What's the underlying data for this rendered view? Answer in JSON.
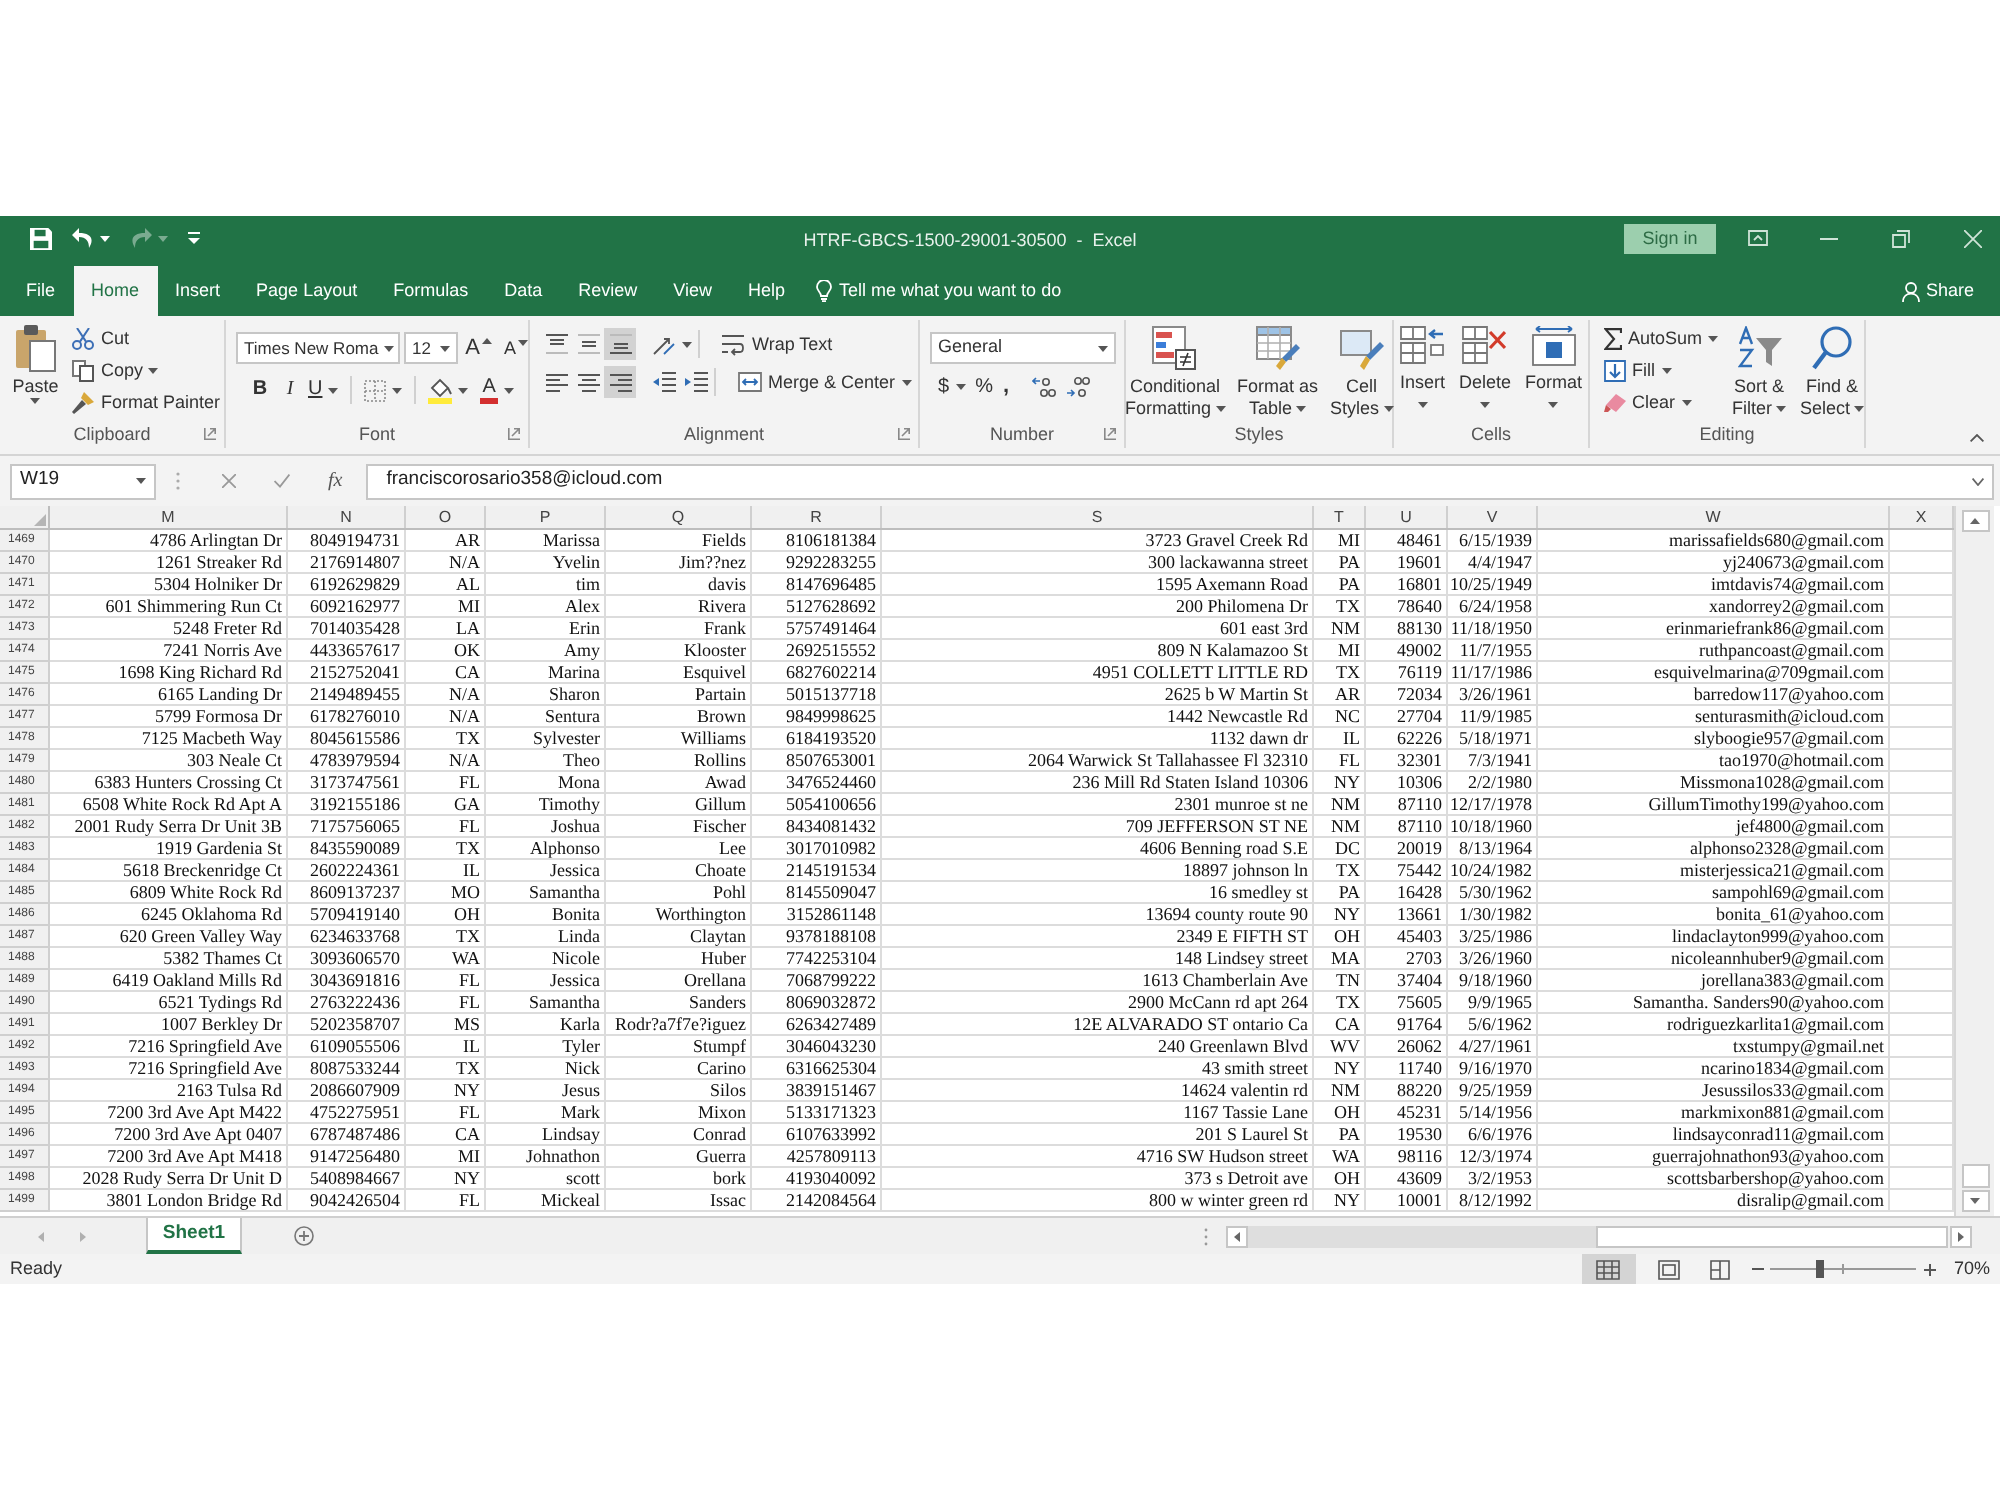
{
  "window": {
    "title": "HTRF-GBCS-1500-29001-30500  -  Excel",
    "sign_in": "Sign in"
  },
  "quick_access": {
    "redo": {
      "disabled": true
    }
  },
  "ribbon_tabs": [
    {
      "label": "File",
      "selected": false
    },
    {
      "label": "Home",
      "selected": true
    },
    {
      "label": "Insert",
      "selected": false
    },
    {
      "label": "Page Layout",
      "selected": false
    },
    {
      "label": "Formulas",
      "selected": false
    },
    {
      "label": "Data",
      "selected": false
    },
    {
      "label": "Review",
      "selected": false
    },
    {
      "label": "View",
      "selected": false
    },
    {
      "label": "Help",
      "selected": false
    }
  ],
  "tell_me": {
    "placeholder": "Tell me what you want to do"
  },
  "share": "Share",
  "clipboard": {
    "paste": "Paste",
    "cut": "Cut",
    "copy": "Copy",
    "format_painter": "Format Painter",
    "group_label": "Clipboard"
  },
  "font": {
    "name": "Times New Roma",
    "size": "12",
    "grow": "A",
    "shrink": "A",
    "bold": "B",
    "italic": "I",
    "underline": "U",
    "font_color": "A",
    "group_label": "Font"
  },
  "alignment": {
    "vertical": [
      {
        "kind": "top",
        "selected": false
      },
      {
        "kind": "middle",
        "selected": false
      },
      {
        "kind": "bottom",
        "selected": true
      }
    ],
    "horizontal": [
      {
        "kind": "left",
        "selected": false
      },
      {
        "kind": "center",
        "selected": false
      },
      {
        "kind": "right",
        "selected": true
      }
    ],
    "wrap_text": "Wrap Text",
    "merge_center": "Merge & Center",
    "group_label": "Alignment"
  },
  "number": {
    "format": "General",
    "currency": "$",
    "percent": "%",
    "comma": ",",
    "group_label": "Number"
  },
  "styles": {
    "buttons": [
      {
        "kind": "conditional",
        "lines": [
          "Conditional",
          "Formatting"
        ]
      },
      {
        "kind": "table",
        "lines": [
          "Format as",
          "Table"
        ]
      },
      {
        "kind": "cell",
        "lines": [
          "Cell",
          "Styles"
        ]
      }
    ],
    "group_label": "Styles"
  },
  "cells": {
    "buttons": [
      {
        "kind": "insert",
        "label": "Insert"
      },
      {
        "kind": "delete",
        "label": "Delete"
      },
      {
        "kind": "format",
        "label": "Format"
      }
    ],
    "group_label": "Cells"
  },
  "editing": {
    "autosum": "AutoSum",
    "fill": "Fill",
    "clear": "Clear",
    "buttons": [
      {
        "kind": "sort",
        "lines": [
          "Sort &",
          "Filter"
        ]
      },
      {
        "kind": "find",
        "lines": [
          "Find &",
          "Select"
        ]
      }
    ],
    "group_label": "Editing"
  },
  "formula_bar": {
    "name_box": "W19",
    "function_label": "fx",
    "formula": "franciscorosario358@icloud.com"
  },
  "columns": [
    "M",
    "N",
    "O",
    "P",
    "Q",
    "R",
    "S",
    "T",
    "U",
    "V",
    "W",
    "X"
  ],
  "rows": [
    {
      "header": "1469",
      "cells": [
        "4786 Arlingtan Dr",
        "8049194731",
        "AR",
        "Marissa",
        "Fields",
        "8106181384",
        "3723 Gravel Creek Rd",
        "MI",
        "48461",
        "6/15/1939",
        "marissafields680@gmail.com"
      ]
    },
    {
      "header": "1470",
      "cells": [
        "1261 Streaker Rd",
        "2176914807",
        "N/A",
        "Yvelin",
        "Jim??nez",
        "9292283255",
        "300 lackawanna street",
        "PA",
        "19601",
        "4/4/1947",
        "yj240673@gmail.com"
      ]
    },
    {
      "header": "1471",
      "cells": [
        "5304 Holniker Dr",
        "6192629829",
        "AL",
        "tim",
        "davis",
        "8147696485",
        "1595 Axemann Road",
        "PA",
        "16801",
        "10/25/1949",
        "imtdavis74@gmail.com"
      ]
    },
    {
      "header": "1472",
      "cells": [
        "601 Shimmering Run Ct",
        "6092162977",
        "MI",
        "Alex",
        "Rivera",
        "5127628692",
        "200 Philomena Dr",
        "TX",
        "78640",
        "6/24/1958",
        "xandorrey2@gmail.com"
      ]
    },
    {
      "header": "1473",
      "cells": [
        "5248 Freter Rd",
        "7014035428",
        "LA",
        "Erin",
        "Frank",
        "5757491464",
        "601 east 3rd",
        "NM",
        "88130",
        "11/18/1950",
        "erinmariefrank86@gmail.com"
      ]
    },
    {
      "header": "1474",
      "cells": [
        "7241 Norris Ave",
        "4433657617",
        "OK",
        "Amy",
        "Klooster",
        "2692515552",
        "809 N Kalamazoo St",
        "MI",
        "49002",
        "11/7/1955",
        "ruthpancoast@gmail.com"
      ]
    },
    {
      "header": "1475",
      "cells": [
        "1698 King Richard Rd",
        "2152752041",
        "CA",
        "Marina",
        "Esquivel",
        "6827602214",
        "4951 COLLETT LITTLE RD",
        "TX",
        "76119",
        "11/17/1986",
        "esquivelmarina@709gmail.com"
      ]
    },
    {
      "header": "1476",
      "cells": [
        "6165 Landing Dr",
        "2149489455",
        "N/A",
        "Sharon",
        "Partain",
        "5015137718",
        "2625 b W Martin St",
        "AR",
        "72034",
        "3/26/1961",
        "barredow117@yahoo.com"
      ]
    },
    {
      "header": "1477",
      "cells": [
        "5799 Formosa Dr",
        "6178276010",
        "N/A",
        "Sentura",
        "Brown",
        "9849998625",
        "1442 Newcastle Rd",
        "NC",
        "27704",
        "11/9/1985",
        "senturasmith@icloud.com"
      ]
    },
    {
      "header": "1478",
      "cells": [
        "7125 Macbeth Way",
        "8045615586",
        "TX",
        "Sylvester",
        "Williams",
        "6184193520",
        "1132 dawn dr",
        "IL",
        "62226",
        "5/18/1971",
        "slyboogie957@gmail.com"
      ]
    },
    {
      "header": "1479",
      "cells": [
        "303 Neale Ct",
        "4783979594",
        "N/A",
        "Theo",
        "Rollins",
        "8507653001",
        "2064 Warwick St Tallahassee Fl 32310",
        "FL",
        "32301",
        "7/3/1941",
        "tao1970@hotmail.com"
      ]
    },
    {
      "header": "1480",
      "cells": [
        "6383 Hunters Crossing Ct",
        "3173747561",
        "FL",
        "Mona",
        "Awad",
        "3476524460",
        "236 Mill Rd Staten Island 10306",
        "NY",
        "10306",
        "2/2/1980",
        "Missmona1028@gmail.com"
      ]
    },
    {
      "header": "1481",
      "cells": [
        "6508 White Rock Rd Apt A",
        "3192155186",
        "GA",
        "Timothy",
        "Gillum",
        "5054100656",
        "2301 munroe st ne",
        "NM",
        "87110",
        "12/17/1978",
        "GillumTimothy199@yahoo.com"
      ]
    },
    {
      "header": "1482",
      "cells": [
        "2001 Rudy Serra Dr Unit 3B",
        "7175756065",
        "FL",
        "Joshua",
        "Fischer",
        "8434081432",
        "709 JEFFERSON ST NE",
        "NM",
        "87110",
        "10/18/1960",
        "jef4800@gmail.com"
      ]
    },
    {
      "header": "1483",
      "cells": [
        "1919 Gardenia St",
        "8435590089",
        "TX",
        "Alphonso",
        "Lee",
        "3017010982",
        "4606 Benning road S.E",
        "DC",
        "20019",
        "8/13/1964",
        "alphonso2328@gmail.com"
      ]
    },
    {
      "header": "1484",
      "cells": [
        "5618 Breckenridge Ct",
        "2602224361",
        "IL",
        "Jessica",
        "Choate",
        "2145191534",
        "18897 johnson ln",
        "TX",
        "75442",
        "10/24/1982",
        "misterjessica21@gmail.com"
      ]
    },
    {
      "header": "1485",
      "cells": [
        "6809 White Rock Rd",
        "8609137237",
        "MO",
        "Samantha",
        "Pohl",
        "8145509047",
        "16 smedley st",
        "PA",
        "16428",
        "5/30/1962",
        "sampohl69@gmail.com"
      ]
    },
    {
      "header": "1486",
      "cells": [
        "6245 Oklahoma Rd",
        "5709419140",
        "OH",
        "Bonita",
        "Worthington",
        "3152861148",
        "13694 county route 90",
        "NY",
        "13661",
        "1/30/1982",
        "bonita_61@yahoo.com"
      ]
    },
    {
      "header": "1487",
      "cells": [
        "620 Green Valley Way",
        "6234633768",
        "TX",
        "Linda",
        "Claytan",
        "9378188108",
        "2349 E FIFTH ST",
        "OH",
        "45403",
        "3/25/1986",
        "lindaclayton999@yahoo.com"
      ]
    },
    {
      "header": "1488",
      "cells": [
        "5382 Thames Ct",
        "3093606570",
        "WA",
        "Nicole",
        "Huber",
        "7742253104",
        "148 Lindsey street",
        "MA",
        "2703",
        "3/26/1960",
        "nicoleannhuber9@gmail.com"
      ]
    },
    {
      "header": "1489",
      "cells": [
        "6419 Oakland Mills Rd",
        "3043691816",
        "FL",
        "Jessica",
        "Orellana",
        "7068799222",
        "1613 Chamberlain Ave",
        "TN",
        "37404",
        "9/18/1960",
        "jorellana383@gmail.com"
      ]
    },
    {
      "header": "1490",
      "cells": [
        "6521 Tydings Rd",
        "2763222436",
        "FL",
        "Samantha",
        "Sanders",
        "8069032872",
        "2900 McCann rd apt 264",
        "TX",
        "75605",
        "9/9/1965",
        "Samantha. Sanders90@yahoo.com"
      ]
    },
    {
      "header": "1491",
      "cells": [
        "1007 Berkley Dr",
        "5202358707",
        "MS",
        "Karla",
        "Rodr?a7f7e?iguez",
        "6263427489",
        "12E ALVARADO ST ontario Ca",
        "CA",
        "91764",
        "5/6/1962",
        "rodriguezkarlita1@gmail.com"
      ]
    },
    {
      "header": "1492",
      "cells": [
        "7216 Springfield Ave",
        "6109055506",
        "IL",
        "Tyler",
        "Stumpf",
        "3046043230",
        "240 Greenlawn Blvd",
        "WV",
        "26062",
        "4/27/1961",
        "txstumpy@gmail.net"
      ]
    },
    {
      "header": "1493",
      "cells": [
        "7216 Springfield Ave",
        "8087533244",
        "TX",
        "Nick",
        "Carino",
        "6316625304",
        "43 smith street",
        "NY",
        "11740",
        "9/16/1970",
        "ncarino1834@gmail.com"
      ]
    },
    {
      "header": "1494",
      "cells": [
        "2163 Tulsa Rd",
        "2086607909",
        "NY",
        "Jesus",
        "Silos",
        "3839151467",
        "14624 valentin rd",
        "NM",
        "88220",
        "9/25/1959",
        "Jesussilos33@gmail.com"
      ]
    },
    {
      "header": "1495",
      "cells": [
        "7200 3rd Ave Apt M422",
        "4752275951",
        "FL",
        "Mark",
        "Mixon",
        "5133171323",
        "1167 Tassie Lane",
        "OH",
        "45231",
        "5/14/1956",
        "markmixon881@gmail.com"
      ]
    },
    {
      "header": "1496",
      "cells": [
        "7200 3rd Ave Apt 0407",
        "6787487486",
        "CA",
        "Lindsay",
        "Conrad",
        "6107633992",
        "201 S Laurel St",
        "PA",
        "19530",
        "6/6/1976",
        "lindsayconrad11@gmail.com"
      ]
    },
    {
      "header": "1497",
      "cells": [
        "7200 3rd Ave Apt M418",
        "9147256480",
        "MI",
        "Johnathon",
        "Guerra",
        "4257809113",
        "4716 SW Hudson street",
        "WA",
        "98116",
        "12/3/1974",
        "guerrajohnathon93@yahoo.com"
      ]
    },
    {
      "header": "1498",
      "cells": [
        "2028 Rudy Serra Dr Unit D",
        "5408984667",
        "NY",
        "scott",
        "bork",
        "4193040092",
        "373 s Detroit ave",
        "OH",
        "43609",
        "3/2/1953",
        "scottsbarbershop@yahoo.com"
      ]
    },
    {
      "header": "1499",
      "cells": [
        "3801 London Bridge Rd",
        "9042426504",
        "FL",
        "Mickeal",
        "Issac",
        "2142084564",
        "800 w winter green rd",
        "NY",
        "10001",
        "8/12/1992",
        "disralip@gmail.com"
      ]
    }
  ],
  "sheets": [
    {
      "label": "Sheet1",
      "selected": true
    }
  ],
  "status_bar": {
    "status": "Ready",
    "views": [
      {
        "kind": "normal",
        "selected": true
      },
      {
        "kind": "page_layout",
        "selected": false
      },
      {
        "kind": "page_break",
        "selected": false
      }
    ],
    "zoom": {
      "level": 0.34,
      "reading": "70%"
    }
  }
}
